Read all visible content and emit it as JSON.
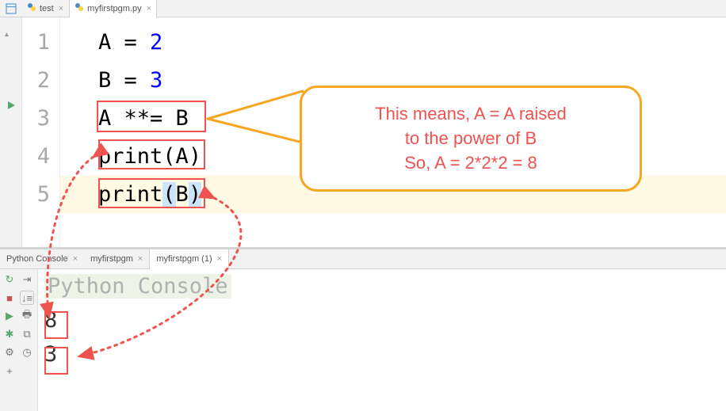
{
  "tabs": {
    "test": "test",
    "file": "myfirstpgm.py"
  },
  "code": {
    "l1": {
      "num": "1",
      "var": "A",
      "eq": " = ",
      "val": "2"
    },
    "l2": {
      "num": "2",
      "var": "B",
      "eq": " = ",
      "val": "3"
    },
    "l3": {
      "num": "3",
      "txt": "A **= B"
    },
    "l4": {
      "num": "4",
      "fn": "print",
      "open": "(",
      "arg": "A",
      "close": ")"
    },
    "l5": {
      "num": "5",
      "fn": "print",
      "open": "(",
      "arg": "B",
      "close": ")"
    }
  },
  "callout": {
    "line1": "This means, A = A raised",
    "line2": "to the power of B",
    "line3": "So, A = 2*2*2 = 8"
  },
  "console_tabs": {
    "pc": "Python Console",
    "m1": "myfirstpgm",
    "m2": "myfirstpgm (1)"
  },
  "console": {
    "title": "Python Console",
    "out1": "8",
    "out2": "3"
  },
  "colors": {
    "annotation": "#ef5350",
    "callout_border": "#f5a623",
    "number": "#0000ff"
  }
}
